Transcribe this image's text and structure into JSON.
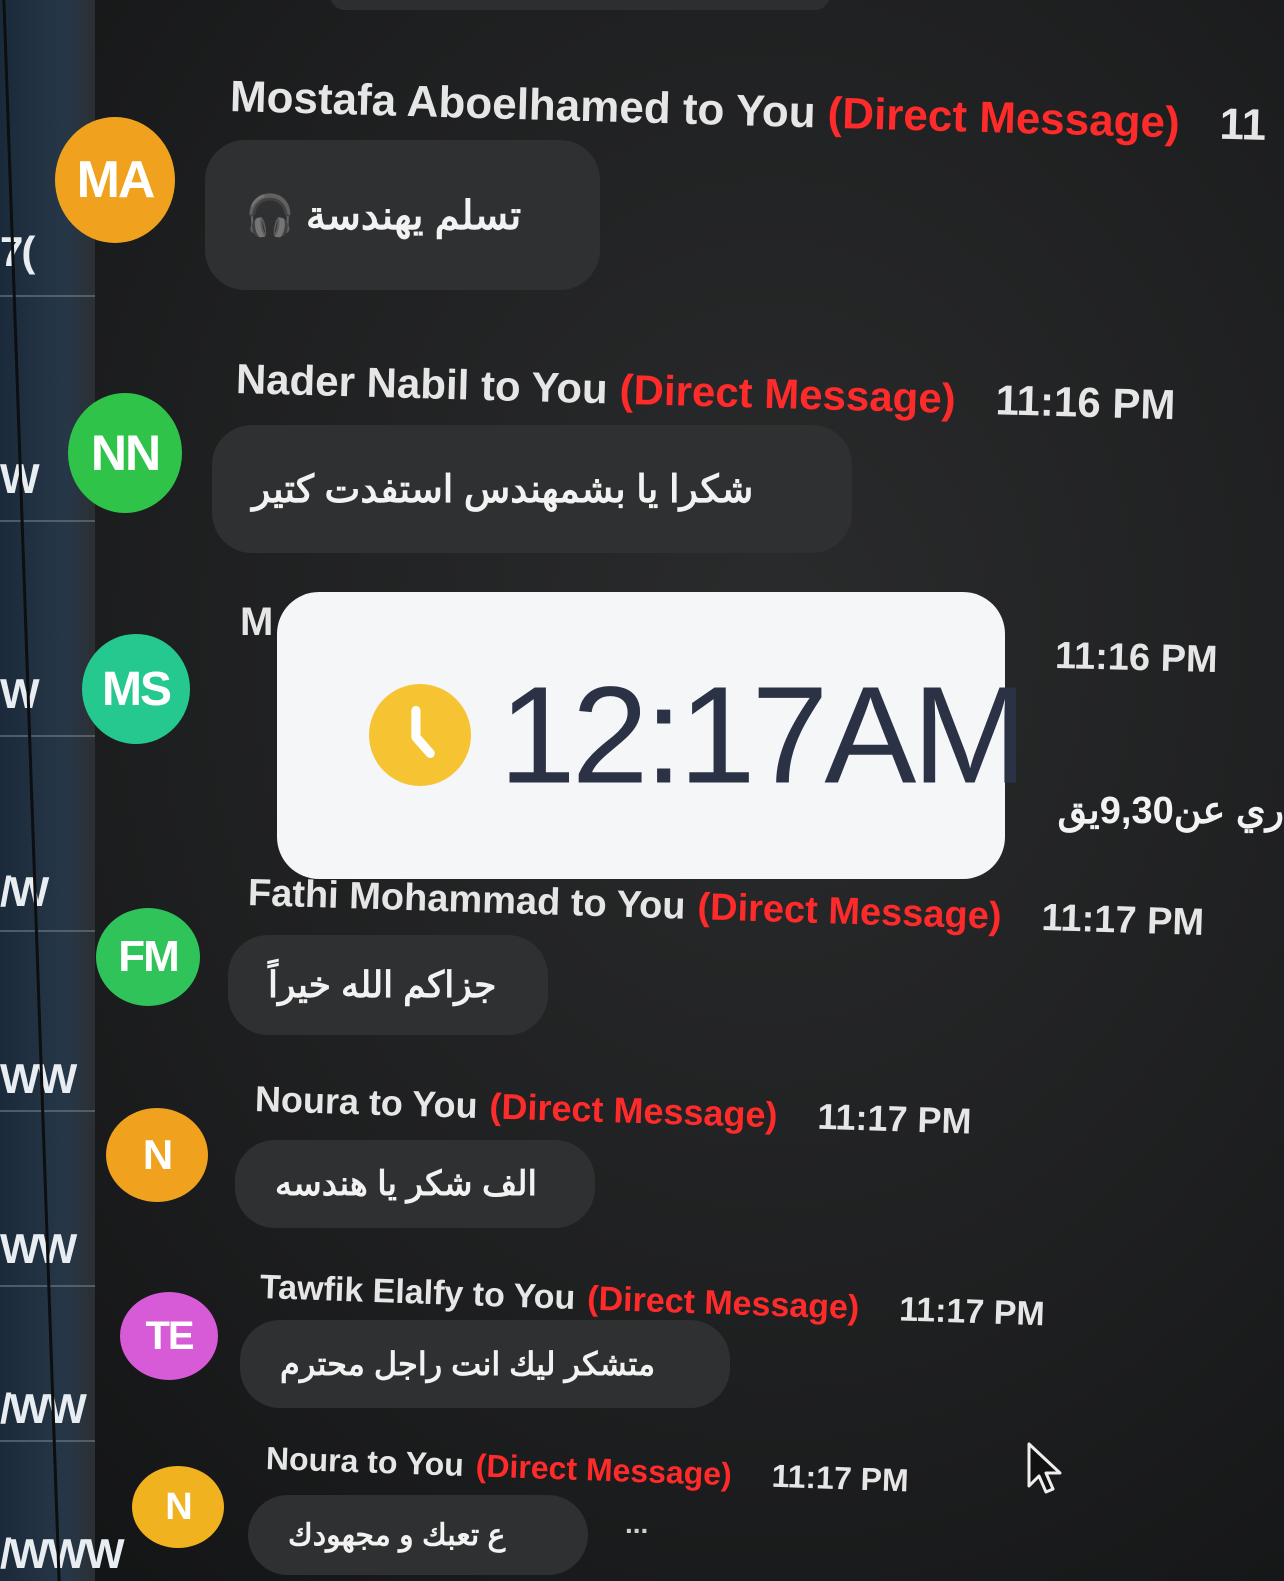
{
  "messages": [
    {
      "initials": "MA",
      "color": "#f0a21f",
      "sender": "Mostafa Aboelhamed to You",
      "dm": "(Direct Message)",
      "time": "11",
      "text": "تسلم يهندسة 🎧"
    },
    {
      "initials": "NN",
      "color": "#2fc34a",
      "sender": "Nader Nabil to You",
      "dm": "(Direct Message)",
      "time": "11:16 PM",
      "text": "شكرا يا بشمهندس استفدت كتير"
    },
    {
      "initials": "MS",
      "color": "#25c98f",
      "sender": "M",
      "dm": "",
      "time": "11:16 PM",
      "text": "ري عن9,30يق"
    },
    {
      "initials": "FM",
      "color": "#2fc35a",
      "sender": "Fathi Mohammad to You",
      "dm": "(Direct Message)",
      "time": "11:17 PM",
      "text": "جزاكم الله خيراً"
    },
    {
      "initials": "N",
      "color": "#f0a21f",
      "sender": "Noura to You",
      "dm": "(Direct Message)",
      "time": "11:17 PM",
      "text": "الف شكر يا هندسه"
    },
    {
      "initials": "TE",
      "color": "#d75ad6",
      "sender": "Tawfik Elalfy to You",
      "dm": "(Direct Message)",
      "time": "11:17 PM",
      "text": "متشكر ليك انت راجل محترم"
    },
    {
      "initials": "N",
      "color": "#f0b21f",
      "sender": "Noura to You",
      "dm": "(Direct Message)",
      "time": "11:17 PM",
      "text": "ع تعبك و مجهودك"
    }
  ],
  "ellipsis": "...",
  "left_strip_labels": [
    "7(",
    "W",
    "W",
    "/W",
    "WW",
    "WW",
    "/WW",
    "/WWW"
  ],
  "overlay": {
    "time": "12:17AM",
    "icon": "clock-icon",
    "icon_color": "#f6c432"
  }
}
